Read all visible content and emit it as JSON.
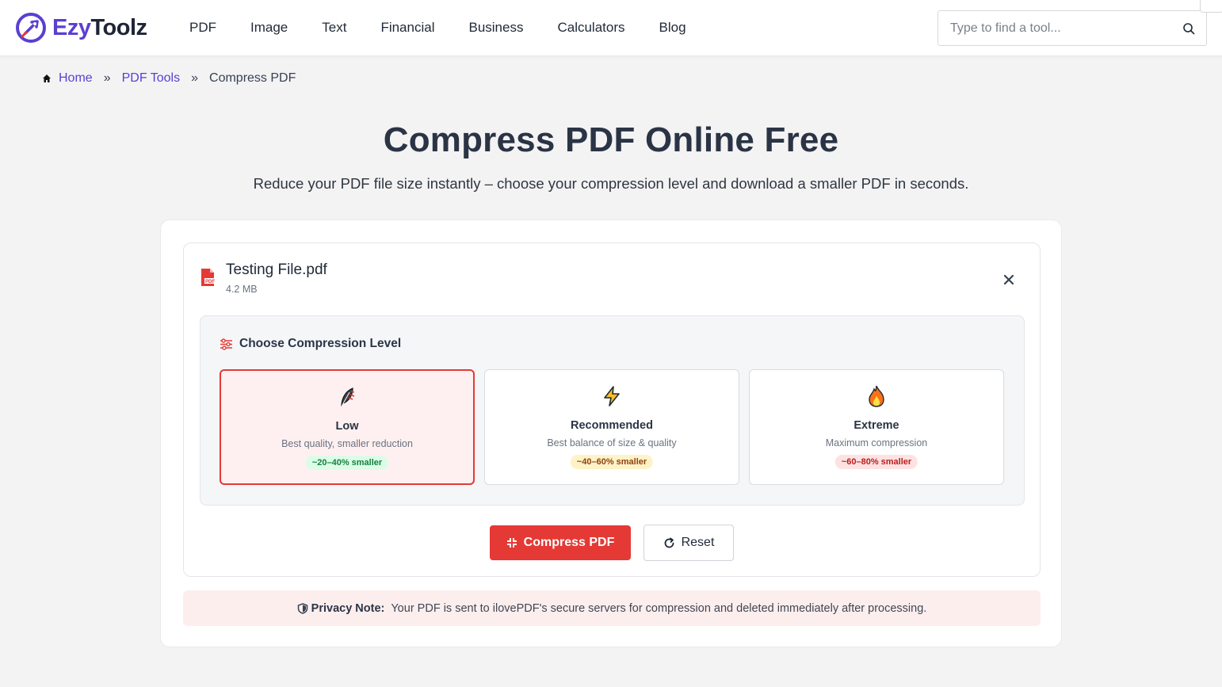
{
  "brand": {
    "name_part1": "Ezy",
    "name_part2": "Toolz"
  },
  "nav": [
    "PDF",
    "Image",
    "Text",
    "Financial",
    "Business",
    "Calculators",
    "Blog"
  ],
  "search": {
    "placeholder": "Type to find a tool..."
  },
  "breadcrumb": {
    "home": "Home",
    "section": "PDF Tools",
    "current": "Compress PDF",
    "separator": "»"
  },
  "hero": {
    "title": "Compress PDF Online Free",
    "subtitle": "Reduce your PDF file size instantly – choose your compression level and download a smaller PDF in seconds."
  },
  "file": {
    "name": "Testing File.pdf",
    "size": "4.2 MB"
  },
  "compression": {
    "heading": "Choose Compression Level",
    "options": [
      {
        "name": "Low",
        "desc": "Best quality, smaller reduction",
        "badge": "~20–40% smaller"
      },
      {
        "name": "Recommended",
        "desc": "Best balance of size & quality",
        "badge": "~40–60% smaller"
      },
      {
        "name": "Extreme",
        "desc": "Maximum compression",
        "badge": "~60–80% smaller"
      }
    ],
    "selected": "Low"
  },
  "actions": {
    "compress_label": "Compress PDF",
    "reset_label": "Reset"
  },
  "privacy": {
    "label": "Privacy Note:",
    "text": "Your PDF is sent to ilovePDF's secure servers for compression and deleted immediately after processing."
  },
  "colors": {
    "accent": "#e53935",
    "brand": "#5b3fd1",
    "background": "#f3f3f4"
  }
}
